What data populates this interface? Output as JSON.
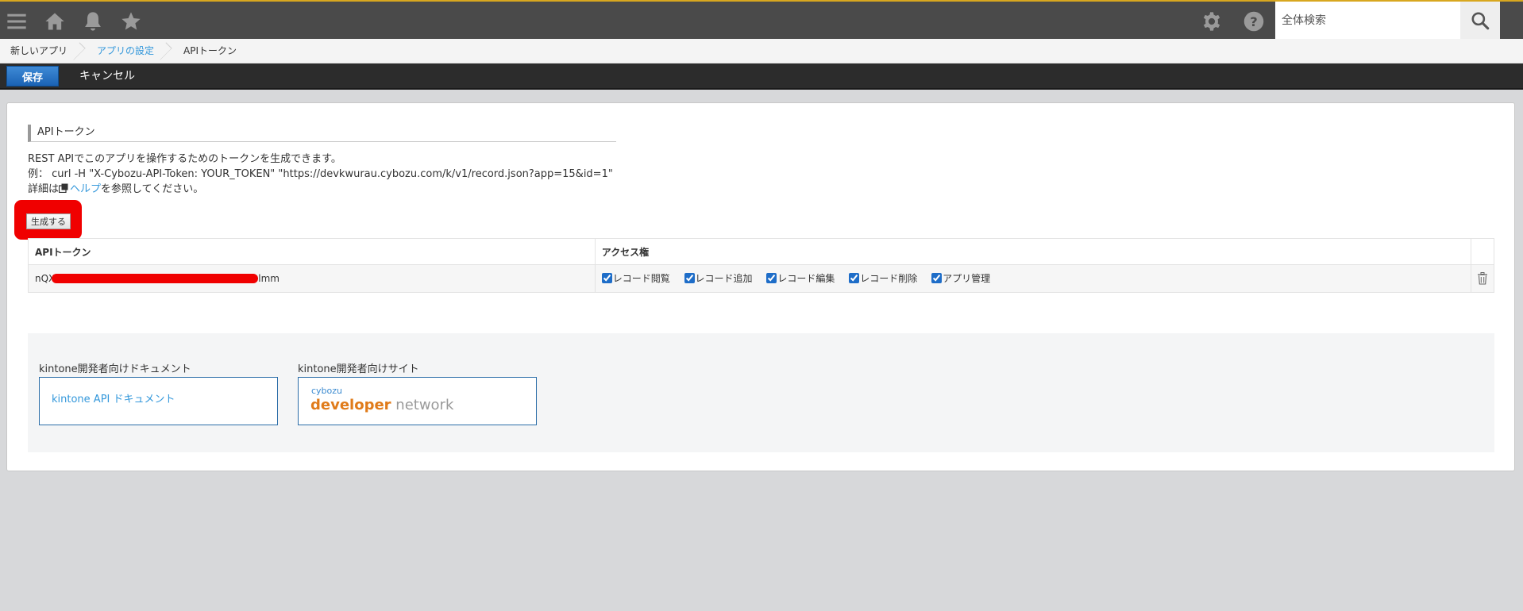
{
  "header": {
    "icons": [
      "menu-icon",
      "home-icon",
      "bell-icon",
      "star-icon",
      "gear-icon",
      "help-icon",
      "search-icon"
    ],
    "search_placeholder": "全体検索",
    "accent_color": "#d8a71f"
  },
  "breadcrumb": {
    "items": [
      "新しいアプリ",
      "アプリの設定",
      "APIトークン"
    ]
  },
  "toolbar": {
    "save_label": "保存",
    "cancel_label": "キャンセル"
  },
  "api_token": {
    "section_title": "APIトークン",
    "description_line1": "REST APIでこのアプリを操作するためのトークンを生成できます。",
    "description_line2": "例： curl -H \"X-Cybozu-API-Token: YOUR_TOKEN\" \"https://devkwurau.cybozu.com/k/v1/record.json?app=15&id=1\"",
    "description_prefix": "詳細は",
    "help_link": "ヘルプ",
    "description_suffix": "を参照してください。",
    "generate_label": "生成する",
    "table": {
      "headers": [
        "APIトークン",
        "アクセス権"
      ],
      "rows": [
        {
          "token_start": "nQX",
          "token_end": "lmm",
          "permissions": [
            {
              "label": "レコード閲覧",
              "checked": true
            },
            {
              "label": "レコード追加",
              "checked": true
            },
            {
              "label": "レコード編集",
              "checked": true
            },
            {
              "label": "レコード削除",
              "checked": true
            },
            {
              "label": "アプリ管理",
              "checked": true
            }
          ]
        }
      ]
    }
  },
  "docs": {
    "doc_label": "kintone開発者向けドキュメント",
    "doc_link": "kintone API ドキュメント",
    "site_label": "kintone開発者向けサイト",
    "site_brand_small": "cybozu",
    "site_brand_developer": "developer",
    "site_brand_network": "network"
  }
}
